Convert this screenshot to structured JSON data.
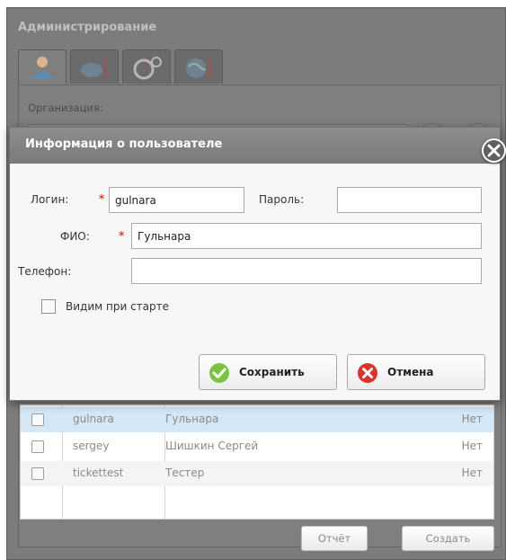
{
  "admin": {
    "title": "Администрирование",
    "tabs": [
      "user-icon",
      "cloud-thermometer-icon",
      "gauge-icon",
      "globe-thermometer-icon"
    ],
    "org_label": "Организация:",
    "report_button": "Отчёт",
    "create_button": "Создать"
  },
  "users": [
    {
      "login": "gulnara",
      "fio": "Гульнара",
      "flag": "Нет",
      "selected": true
    },
    {
      "login": "sergey",
      "fio": "Шишкин Сергей",
      "flag": "Нет",
      "selected": false
    },
    {
      "login": "tickettest",
      "fio": "Тестер",
      "flag": "Нет",
      "selected": false
    }
  ],
  "dialog": {
    "title": "Информация о пользователе",
    "login_label": "Логин:",
    "login_value": "gulnara",
    "password_label": "Пароль:",
    "password_value": "",
    "fio_label": "ФИО:",
    "fio_value": "Гульнара",
    "phone_label": "Телефон:",
    "phone_value": "",
    "visible_label": "Видим при старте",
    "visible_checked": false,
    "save_label": "Сохранить",
    "cancel_label": "Отмена",
    "required_mark": "*"
  },
  "colors": {
    "save_icon": "#7cc243",
    "cancel_icon": "#d9342b",
    "required": "#e03a3a",
    "selected_row": "#d4e7f7"
  }
}
